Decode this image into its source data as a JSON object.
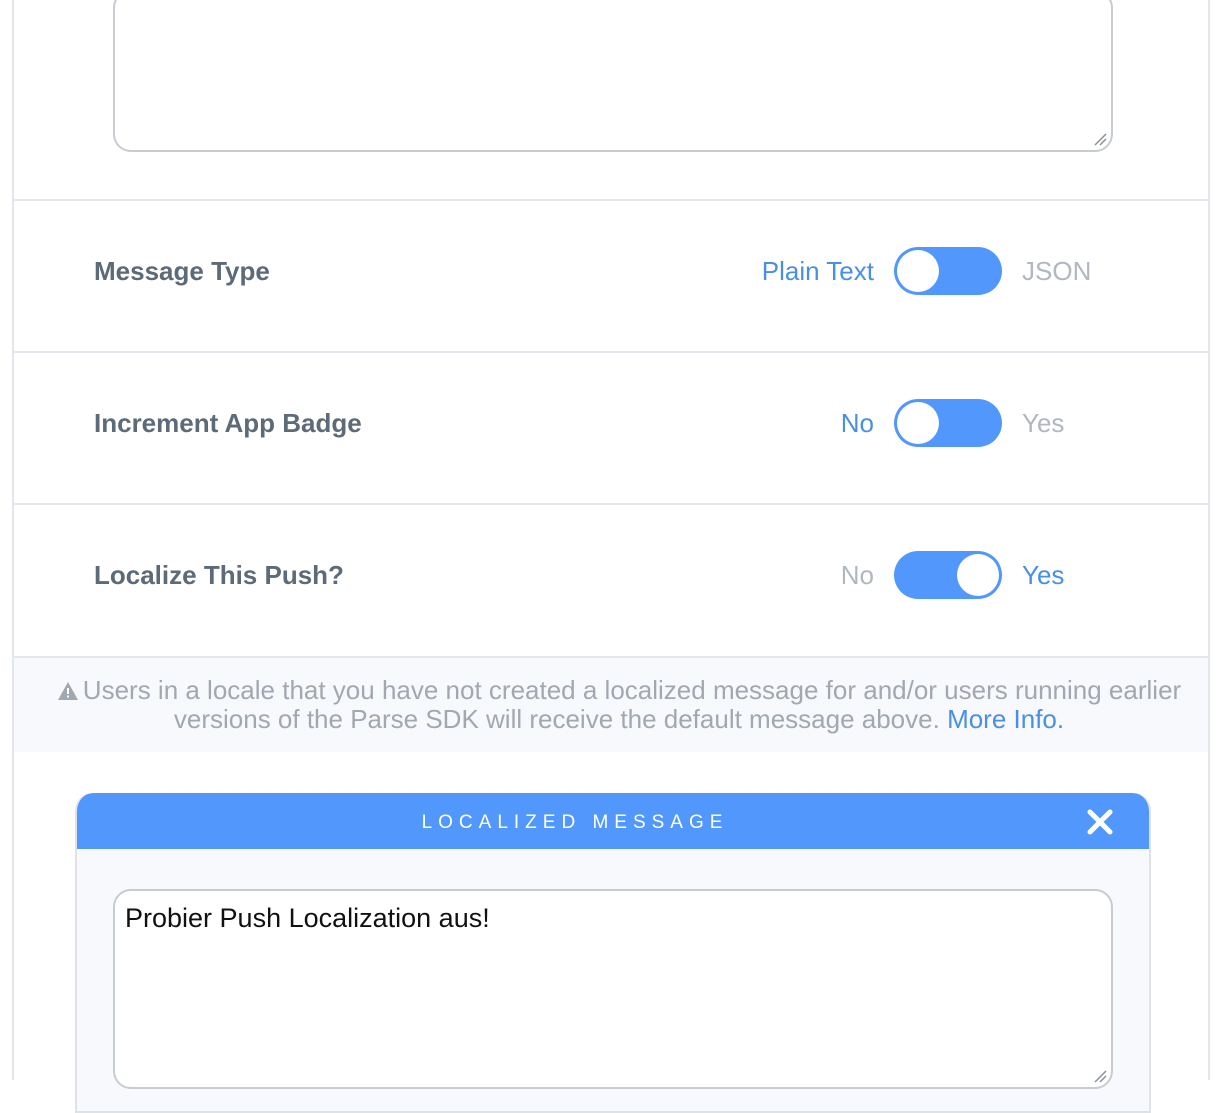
{
  "rows": [
    {
      "label": "Message Type",
      "off_label": "Plain Text",
      "on_label": "JSON",
      "state": "off"
    },
    {
      "label": "Increment App Badge",
      "off_label": "No",
      "on_label": "Yes",
      "state": "off"
    },
    {
      "label": "Localize This Push?",
      "off_label": "No",
      "on_label": "Yes",
      "state": "on"
    }
  ],
  "info": {
    "warning_text": "Users in a locale that you have not created a localized message for and/or users running earlier versions of the Parse SDK will receive the default message above.",
    "link_text": "More Info."
  },
  "localized_message": {
    "title": "LOCALIZED MESSAGE",
    "text": "Probier Push Localization aus!"
  },
  "colors": {
    "accent": "#5298fc",
    "link": "#4a90e2",
    "label": "#5d6a78",
    "muted": "#b1b7bf"
  },
  "icons": {
    "warning": "warning-triangle-icon",
    "close": "close-icon",
    "resize": "resize-grip-icon"
  }
}
